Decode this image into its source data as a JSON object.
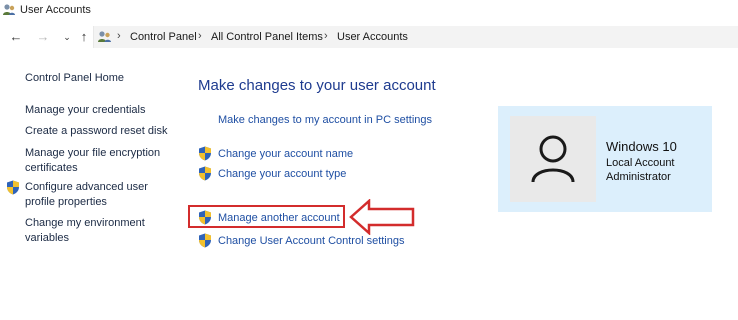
{
  "window": {
    "title": "User Accounts"
  },
  "nav": {
    "back": "back-arrow",
    "forward": "forward-arrow",
    "recent": "chevron-down",
    "up": "up-arrow"
  },
  "breadcrumb": [
    "Control Panel",
    "All Control Panel Items",
    "User Accounts"
  ],
  "sidebar": {
    "home": "Control Panel Home",
    "items": [
      {
        "label": "Manage your credentials"
      },
      {
        "label": "Create a password reset disk"
      },
      {
        "label": "Manage your file encryption",
        "label2": "certificates"
      },
      {
        "label": "Configure advanced user",
        "label2": "profile properties"
      },
      {
        "label": "Change my environment",
        "label2": "variables"
      }
    ]
  },
  "main": {
    "heading": "Make changes to your user account",
    "pc_settings_link": "Make changes to my account in PC settings",
    "change_name": "Change your account name",
    "change_type": "Change your account type",
    "manage_another": "Manage another account",
    "uac_settings": "Change User Account Control settings"
  },
  "account": {
    "name": "Windows 10",
    "type": "Local Account",
    "role": "Administrator"
  },
  "colors": {
    "accent_link": "#1f4fa3",
    "heading": "#1e3b8f",
    "highlight": "#d32c2c",
    "account_panel": "#dceffc"
  }
}
